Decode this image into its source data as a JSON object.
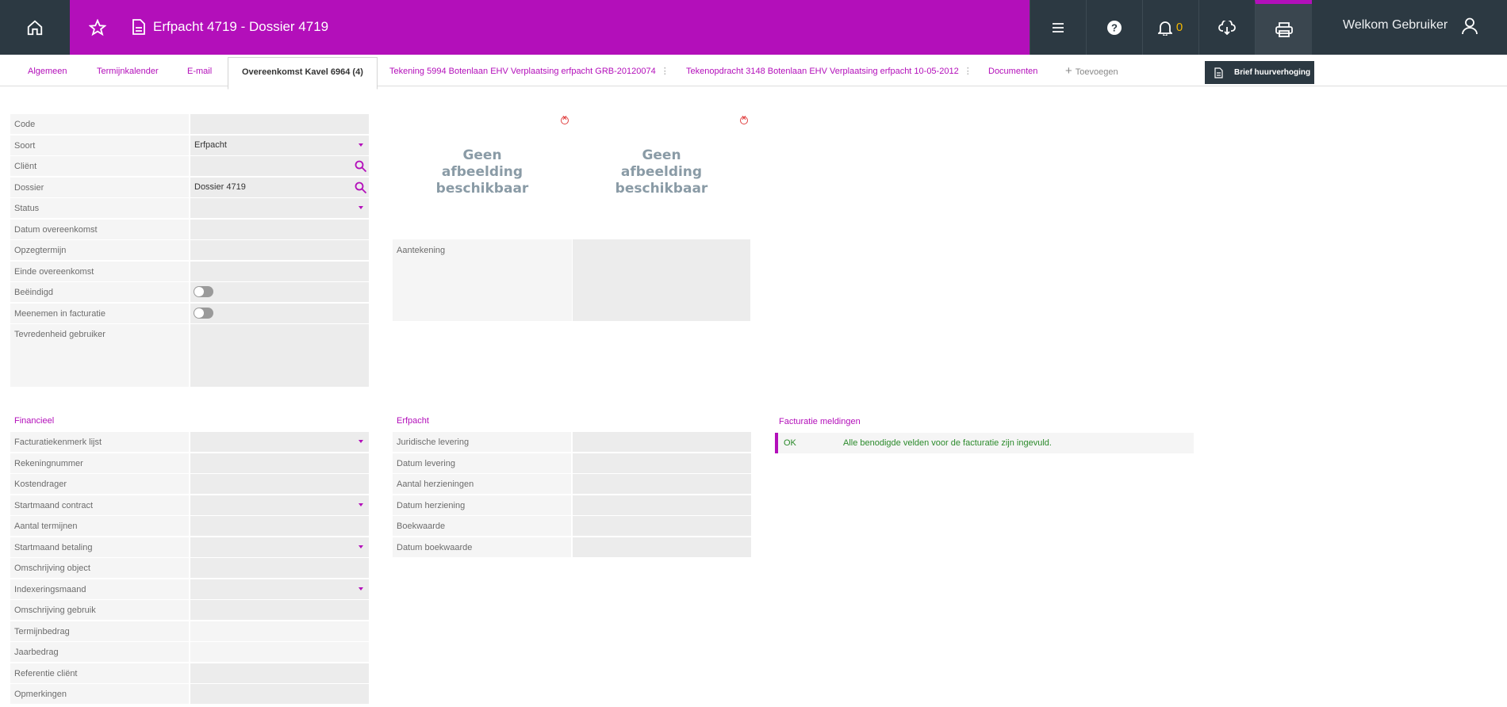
{
  "header": {
    "title": "Erfpacht 4719 - Dossier 4719",
    "notification_count": "0",
    "welcome": "Welkom Gebruiker",
    "brand_color": "#b30fba",
    "dark_color": "#2c3942"
  },
  "tabs": [
    {
      "label": "Algemeen"
    },
    {
      "label": "Termijnkalender"
    },
    {
      "label": "E-mail"
    },
    {
      "label": "Overeenkomst Kavel 6964 (4)",
      "active": true
    },
    {
      "label": "Tekening 5994 Botenlaan EHV Verplaatsing erfpacht GRB-20120074"
    },
    {
      "label": "Tekenopdracht 3148 Botenlaan EHV Verplaatsing erfpacht 10-05-2012"
    },
    {
      "label": "Documenten"
    },
    {
      "label": "Toevoegen"
    }
  ],
  "tooltip": "Brief huurverhoging",
  "main_form": {
    "rows": [
      {
        "label": "Code",
        "value": ""
      },
      {
        "label": "Soort",
        "value": "Erfpacht"
      },
      {
        "label": "Cliënt",
        "value": ""
      },
      {
        "label": "Dossier",
        "value": "Dossier 4719"
      },
      {
        "label": "Status",
        "value": ""
      },
      {
        "label": "Datum overeenkomst",
        "value": ""
      },
      {
        "label": "Opzegtermijn",
        "value": ""
      },
      {
        "label": "Einde overeenkomst",
        "value": ""
      },
      {
        "label": "Beëindigd",
        "value": ""
      },
      {
        "label": "Meenemen in facturatie",
        "value": ""
      },
      {
        "label": "Tevredenheid gebruiker",
        "value": ""
      }
    ]
  },
  "images": {
    "placeholder_1": "Geen afbeelding beschikbaar",
    "placeholder_2": "Geen afbeelding beschikbaar"
  },
  "note_label": "Aantekening",
  "financieel": {
    "title": "Financieel",
    "rows": [
      {
        "label": "Facturatiekenmerk lijst"
      },
      {
        "label": "Rekeningnummer"
      },
      {
        "label": "Kostendrager"
      },
      {
        "label": "Startmaand contract"
      },
      {
        "label": "Aantal termijnen"
      },
      {
        "label": "Startmaand betaling"
      },
      {
        "label": "Omschrijving object"
      },
      {
        "label": "Indexeringsmaand"
      },
      {
        "label": "Omschrijving gebruik"
      },
      {
        "label": "Termijnbedrag"
      },
      {
        "label": "Jaarbedrag"
      },
      {
        "label": "Referentie cliënt"
      },
      {
        "label": "Opmerkingen"
      }
    ]
  },
  "erfpacht": {
    "title": "Erfpacht",
    "rows": [
      {
        "label": "Juridische levering"
      },
      {
        "label": "Datum levering"
      },
      {
        "label": "Aantal herzieningen"
      },
      {
        "label": "Datum herziening"
      },
      {
        "label": "Boekwaarde"
      },
      {
        "label": "Datum boekwaarde"
      }
    ]
  },
  "facturatie": {
    "title": "Facturatie meldingen",
    "status": "OK",
    "message": "Alle benodigde velden voor de facturatie zijn ingevuld."
  }
}
